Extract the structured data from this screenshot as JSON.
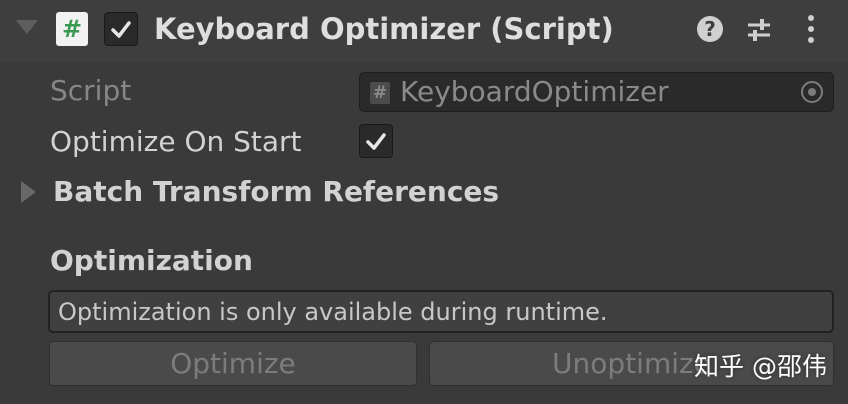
{
  "component": {
    "title": "Keyboard Optimizer (Script)",
    "enabled": true,
    "icons": [
      "foldout-arrow-icon",
      "script-icon",
      "help-icon",
      "preset-icon",
      "kebab-menu-icon"
    ]
  },
  "fields": {
    "script_label": "Script",
    "script_value": "KeyboardOptimizer",
    "script_icon_glyph": "#",
    "optimize_on_start_label": "Optimize On Start",
    "optimize_on_start_value": true,
    "batch_label": "Batch Transform References"
  },
  "optimization": {
    "header": "Optimization",
    "help_text": "Optimization is only available during runtime.",
    "optimize_button": "Optimize",
    "unoptimize_button": "Unoptimize"
  },
  "watermark": "知乎 @邵伟",
  "colors": {
    "background": "#3a3a3a",
    "header_background": "#3e3e3e",
    "field_background": "#2a2a2a",
    "script_icon_green": "#3a9a52"
  }
}
